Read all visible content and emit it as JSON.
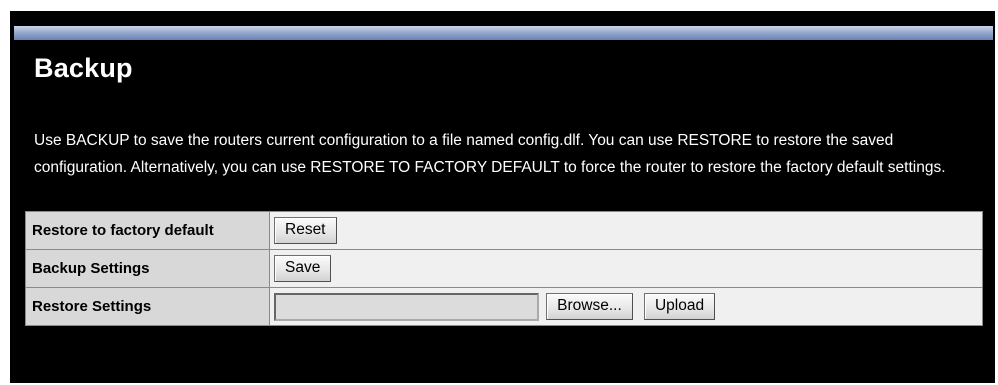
{
  "page": {
    "title": "Backup",
    "description": "Use BACKUP to save the routers current configuration to a file named config.dlf. You can use RESTORE to restore the saved configuration. Alternatively, you can use RESTORE TO FACTORY DEFAULT to force the router to restore the factory default settings."
  },
  "rows": {
    "factory": {
      "label": "Restore to factory default",
      "button": "Reset"
    },
    "backup": {
      "label": "Backup Settings",
      "button": "Save"
    },
    "restore": {
      "label": "Restore Settings",
      "file_value": "",
      "browse_button": "Browse...",
      "upload_button": "Upload"
    }
  }
}
